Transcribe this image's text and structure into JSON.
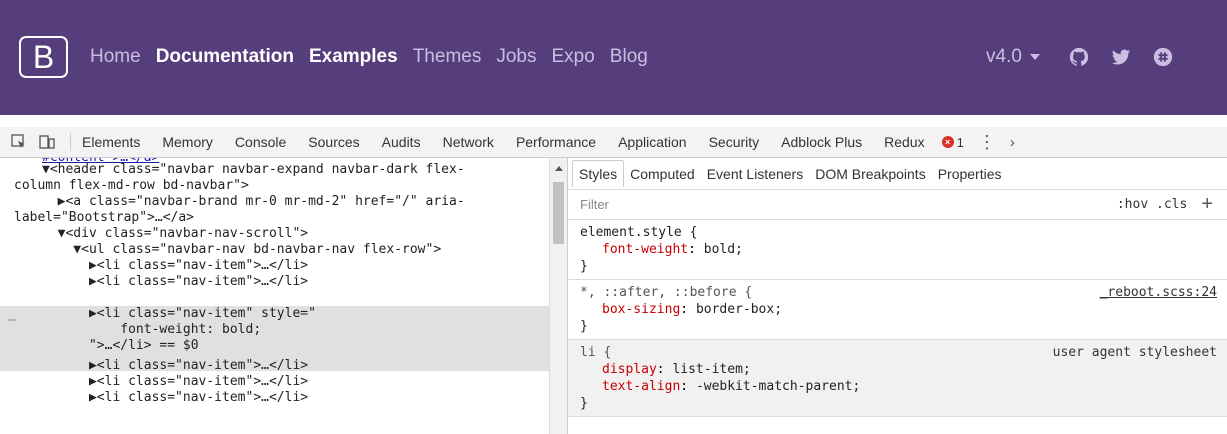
{
  "navbar": {
    "brand": "B",
    "links": [
      {
        "label": "Home",
        "bold": false
      },
      {
        "label": "Documentation",
        "bold": true
      },
      {
        "label": "Examples",
        "bold": true
      },
      {
        "label": "Themes",
        "bold": false
      },
      {
        "label": "Jobs",
        "bold": false
      },
      {
        "label": "Expo",
        "bold": false
      },
      {
        "label": "Blog",
        "bold": false
      }
    ],
    "version": "v4.0",
    "icons": [
      "github-icon",
      "twitter-icon",
      "slack-icon"
    ],
    "bg_color": "#563d7c"
  },
  "devtools": {
    "tabs": [
      "Elements",
      "Memory",
      "Console",
      "Sources",
      "Audits",
      "Network",
      "Performance",
      "Application",
      "Security",
      "Adblock Plus",
      "Redux"
    ],
    "error_count": "1"
  },
  "elements": {
    "lines": [
      {
        "text": "▼<header class=\"navbar navbar-expand navbar-dark flex-"
      },
      {
        "text": "column flex-md-row bd-navbar\">"
      },
      {
        "text": "  ▶<a class=\"navbar-brand mr-0 mr-md-2\" href=\"/\" aria-"
      },
      {
        "text": "label=\"Bootstrap\">…</a>"
      },
      {
        "text": "  ▼<div class=\"navbar-nav-scroll\">"
      },
      {
        "text": "    ▼<ul class=\"navbar-nav bd-navbar-nav flex-row\">"
      },
      {
        "text": "      ▶<li class=\"nav-item\">…</li>"
      },
      {
        "text": "      ▶<li class=\"nav-item\">…</li>"
      },
      {
        "text": "      ▶<li class=\"nav-item\" style=\""
      },
      {
        "text": "          font-weight: bold;"
      },
      {
        "text": "      \">…</li> == $0"
      },
      {
        "text": "      ▶<li class=\"nav-item\">…</li>"
      },
      {
        "text": "      ▶<li class=\"nav-item\">…</li>"
      },
      {
        "text": "      ▶<li class=\"nav-item\">…</li>"
      }
    ],
    "selected_dots": "…"
  },
  "styles": {
    "tabs": [
      "Styles",
      "Computed",
      "Event Listeners",
      "DOM Breakpoints",
      "Properties"
    ],
    "filter_placeholder": "Filter",
    "hov_cls": ":hov .cls",
    "rules": [
      {
        "selector": "element.style {",
        "source": "",
        "props": [
          {
            "name": "font-weight",
            "value": "bold;"
          }
        ]
      },
      {
        "selector": "*, ::after, ::before {",
        "source": "_reboot.scss:24",
        "props": [
          {
            "name": "box-sizing",
            "value": "border-box;"
          }
        ]
      },
      {
        "selector": "li {",
        "source": "user agent stylesheet",
        "props": [
          {
            "name": "display",
            "value": "list-item;"
          },
          {
            "name": "text-align",
            "value": "-webkit-match-parent;"
          }
        ]
      }
    ]
  }
}
